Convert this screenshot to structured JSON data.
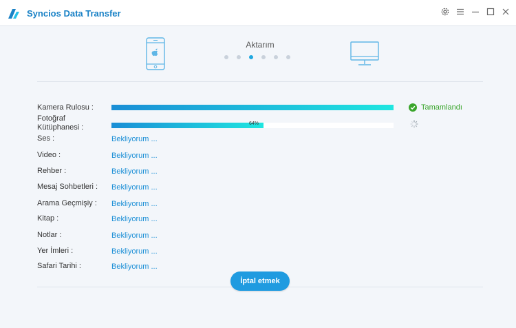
{
  "window": {
    "title": "Syncios Data Transfer",
    "controls": [
      "settings-icon",
      "menu-icon",
      "minimize-icon",
      "maximize-icon",
      "close-icon"
    ]
  },
  "header": {
    "step_title": "Aktarım",
    "steps_total": 6,
    "active_step": 3,
    "source_device_icon": "iphone-icon",
    "target_device_icon": "monitor-icon"
  },
  "transfer_items": [
    {
      "label": "Kamera Rulosu",
      "state": "complete",
      "progress": 1.0,
      "status_text": "Tamamlandı"
    },
    {
      "label": "Fotoğraf\nKütüphanesi",
      "state": "in-progress",
      "progress": 0.64,
      "percent_text": "64%"
    },
    {
      "label": "Ses",
      "state": "waiting",
      "status_text": "Bekliyorum ..."
    },
    {
      "label": "Video",
      "state": "waiting",
      "status_text": "Bekliyorum ..."
    },
    {
      "label": "Rehber",
      "state": "waiting",
      "status_text": "Bekliyorum ..."
    },
    {
      "label": "Mesaj Sohbetleri",
      "state": "waiting",
      "status_text": "Bekliyorum ..."
    },
    {
      "label": "Arama Geçmişiy",
      "state": "waiting",
      "status_text": "Bekliyorum ..."
    },
    {
      "label": "Kitap",
      "state": "waiting",
      "status_text": "Bekliyorum ..."
    },
    {
      "label": "Notlar",
      "state": "waiting",
      "status_text": "Bekliyorum ..."
    },
    {
      "label": "Yer İmleri",
      "state": "waiting",
      "status_text": "Bekliyorum ..."
    },
    {
      "label": "Safari Tarihi",
      "state": "waiting",
      "status_text": "Bekliyorum ..."
    }
  ],
  "footer": {
    "cancel_label": "İptal etmek"
  },
  "colors": {
    "accent": "#1f9be0",
    "link": "#1a8ed6",
    "success": "#3aa52b",
    "progress_start": "#1a8ed6",
    "progress_end": "#1fe6e0"
  }
}
